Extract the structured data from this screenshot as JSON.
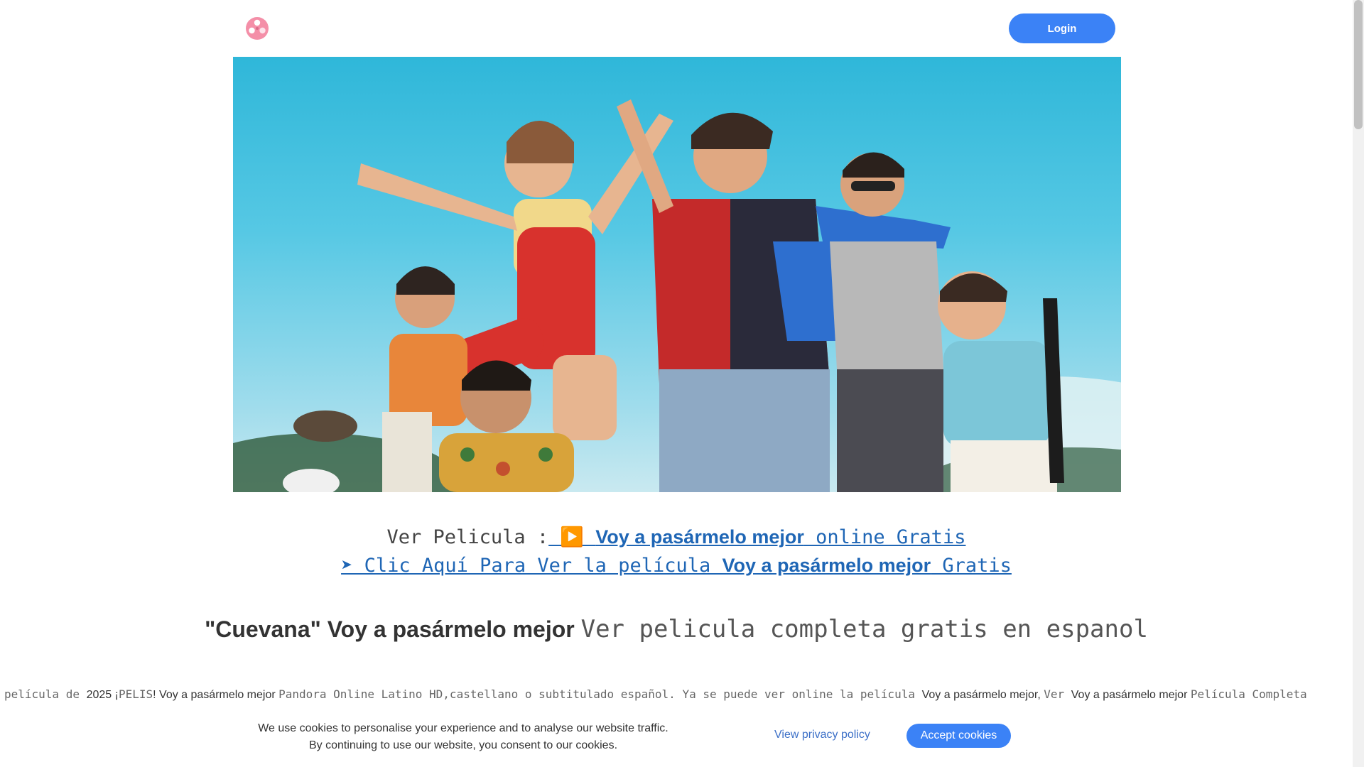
{
  "header": {
    "logo_icon": "film-reel-icon",
    "login_label": "Login"
  },
  "hero": {
    "image_description_icon": "movie-poster-image"
  },
  "cta": {
    "line1_label": "Ver Pelicula :",
    "line1_link_prefix": " ▶️ ",
    "line1_link_title": "Voy a pasármelo mejor",
    "line1_link_suffix": " online Gratis",
    "line2_link_prefix": "➤ Clic Aquí Para Ver la película ",
    "line2_link_title": "Voy a pasármelo mejor",
    "line2_link_suffix": " Gratis"
  },
  "heading": {
    "part1": "\"Cuevana\" Voy a pasármelo mejor ",
    "part2": "Ver pelicula completa gratis en espanol"
  },
  "body": {
    "s1": "película de ",
    "s2": "2025",
    "s3": " ¡",
    "s4": "PELIS",
    "s5": "! Voy a pasármelo mejor ",
    "s6": "Pandora Online Latino HD,castellano o subtitulado español. Ya se puede ver online la película ",
    "s7": "Voy a pasármelo mejor, ",
    "s8": "Ver ",
    "s9": "Voy a pasármelo mejor ",
    "s10": "Película Completa"
  },
  "cookie": {
    "line1": "We use cookies to personalise your experience and to analyse our website traffic.",
    "line2": "By continuing to use our website, you consent to our cookies.",
    "privacy_label": "View privacy policy",
    "accept_label": "Accept cookies"
  },
  "colors": {
    "accent": "#3b82f6",
    "link": "#1f66b5"
  }
}
